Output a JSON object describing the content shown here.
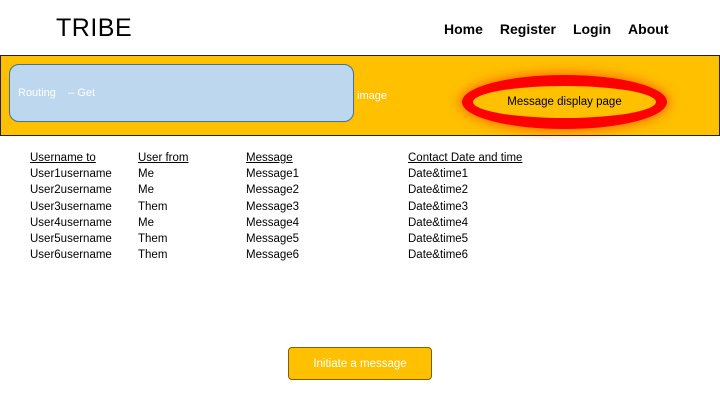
{
  "header": {
    "logo": "TRIBE",
    "nav": [
      "Home",
      "Register",
      "Login",
      "About"
    ]
  },
  "banner": {
    "routing_text": "Routing    – Get",
    "image_text": "image",
    "page_label": "Message display page",
    "colors": {
      "banner": "#ffc000",
      "routing_box": "#bdd7ee",
      "highlight": "#ff0000"
    }
  },
  "table": {
    "headers": [
      "Username to",
      "User from",
      "Message",
      "Contact Date and time"
    ],
    "rows": [
      [
        "User1username",
        "Me",
        "Message1",
        "Date&time1"
      ],
      [
        "User2username",
        "Me",
        "Message2",
        "Date&time2"
      ],
      [
        "User3username",
        "Them",
        "Message3",
        "Date&time3"
      ],
      [
        "User4username",
        "Me",
        "Message4",
        "Date&time4"
      ],
      [
        "User5username",
        "Them",
        "Message5",
        "Date&time5"
      ],
      [
        "User6username",
        "Them",
        "Message6",
        "Date&time6"
      ]
    ]
  },
  "actions": {
    "initiate_label": "Initiate a  message"
  }
}
